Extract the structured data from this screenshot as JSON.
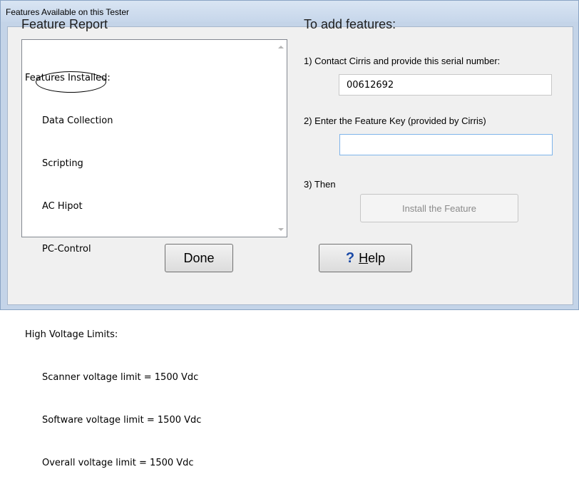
{
  "window": {
    "title": "Features Available on this Tester"
  },
  "report": {
    "heading": "Feature Report",
    "lines": [
      "Features Installed:",
      "Data Collection",
      "Scripting",
      "AC Hipot",
      "PC-Control",
      "",
      "High Voltage Limits:",
      "Scanner voltage limit = 1500 Vdc",
      "Software voltage limit = 1500 Vdc",
      "Overall voltage limit = 1500 Vdc"
    ]
  },
  "add": {
    "heading": "To add features:",
    "step1_label": "1) Contact Cirris and provide this serial number:",
    "serial_number": "00612692",
    "step2_label": "2) Enter the Feature Key (provided by Cirris)",
    "feature_key_value": "",
    "step3_label": "3) Then",
    "install_button": "Install the Feature"
  },
  "buttons": {
    "done": "Done",
    "help_icon": "?",
    "help_prefix": "",
    "help_underlined": "H",
    "help_rest": "elp"
  }
}
